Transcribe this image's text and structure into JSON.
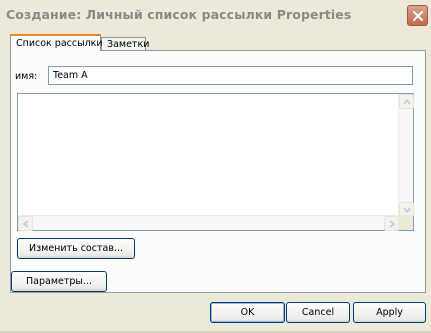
{
  "window": {
    "title": "Создание: Личный список рассылки Properties"
  },
  "tabs": [
    {
      "label": "Список рассылки",
      "active": true
    },
    {
      "label": "Заметки",
      "active": false
    }
  ],
  "form": {
    "name_label": "имя:",
    "name_value": "Team A"
  },
  "buttons": {
    "change_members": "Изменить состав...",
    "parameters": "Параметры...",
    "ok": "OK",
    "cancel": "Cancel",
    "apply": "Apply"
  },
  "icons": {
    "close": "close-icon",
    "scroll_up": "arrow-up-icon",
    "scroll_down": "arrow-down-icon",
    "scroll_left": "arrow-left-icon",
    "scroll_right": "arrow-right-icon"
  },
  "colors": {
    "window_bg": "#ece9d8",
    "active_tab_accent": "#e68b2c",
    "input_border": "#7f9db9",
    "close_button": "#c06a4d"
  }
}
